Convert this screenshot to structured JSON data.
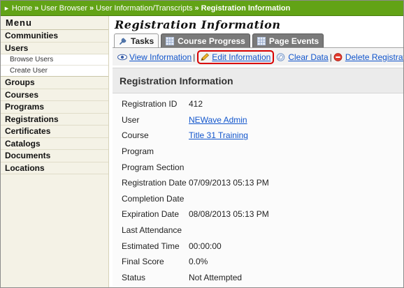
{
  "breadcrumb": {
    "items": [
      "Home",
      "User Browser",
      "User Information/Transcripts"
    ],
    "current": "Registration Information",
    "separator": "»"
  },
  "sidebar": {
    "title": "Menu",
    "items": [
      {
        "label": "Communities"
      },
      {
        "label": "Users",
        "children": [
          "Browse Users",
          "Create User"
        ]
      },
      {
        "label": "Groups"
      },
      {
        "label": "Courses"
      },
      {
        "label": "Programs"
      },
      {
        "label": "Registrations"
      },
      {
        "label": "Certificates"
      },
      {
        "label": "Catalogs"
      },
      {
        "label": "Documents"
      },
      {
        "label": "Locations"
      }
    ]
  },
  "main": {
    "title": "Registration Information",
    "tabs": [
      {
        "label": "Tasks",
        "icon": "wrench-icon",
        "active": true
      },
      {
        "label": "Course Progress",
        "icon": "grid-icon",
        "active": false
      },
      {
        "label": "Page Events",
        "icon": "grid-icon",
        "active": false
      }
    ],
    "actions": [
      {
        "label": "View Information",
        "icon": "eye-icon"
      },
      {
        "label": "Edit Information",
        "icon": "pencil-icon",
        "highlighted": true
      },
      {
        "label": "Clear Data",
        "icon": "eraser-icon"
      },
      {
        "label": "Delete Registration",
        "icon": "delete-icon"
      }
    ],
    "action_separator": "|",
    "panel": {
      "heading": "Registration Information",
      "rows": [
        {
          "label": "Registration ID",
          "value": "412"
        },
        {
          "label": "User",
          "value": "NEWave Admin"
        },
        {
          "label": "Course",
          "value": "Title 31 Training"
        },
        {
          "label": "Program",
          "value": ""
        },
        {
          "label": "Program Section",
          "value": ""
        },
        {
          "label": "Registration Date",
          "value": "07/09/2013 05:13 PM"
        },
        {
          "label": "Completion Date",
          "value": ""
        },
        {
          "label": "Expiration Date",
          "value": "08/08/2013 05:13 PM"
        },
        {
          "label": "Last Attendance",
          "value": ""
        },
        {
          "label": "Estimated Time",
          "value": "00:00:00"
        },
        {
          "label": "Final Score",
          "value": "0.0%"
        },
        {
          "label": "Status",
          "value": "Not Attempted"
        }
      ]
    }
  },
  "colors": {
    "breadcrumb_bg": "#62a316",
    "sidebar_bg": "#f4f2e6",
    "link": "#1155cc",
    "highlight_ring": "#d80000",
    "tab_inactive": "#7a7a7a"
  }
}
